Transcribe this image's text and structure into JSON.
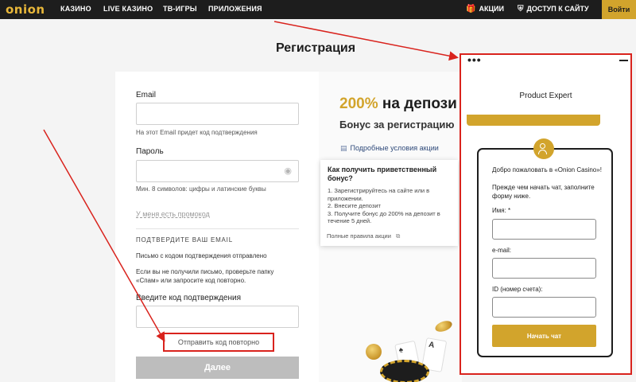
{
  "header": {
    "logo": "onion",
    "nav": [
      "КАЗИНО",
      "LIVE КАЗИНО",
      "ТВ-ИГРЫ",
      "ПРИЛОЖЕНИЯ"
    ],
    "promos_label": "АКЦИИ",
    "access_label": "ДОСТУП К САЙТУ",
    "login_label": "Войти"
  },
  "page": {
    "title": "Регистрация"
  },
  "form": {
    "email_label": "Email",
    "email_value": "",
    "email_hint": "На этот Email придет код подтверждения",
    "password_label": "Пароль",
    "password_value": "",
    "password_hint": "Мин. 8 символов: цифры и латинские буквы",
    "promo_link": "У меня есть промокод",
    "confirm_title": "ПОДТВЕРДИТЕ ВАШ EMAIL",
    "confirm_sent": "Письмо с кодом подтверждения отправлено",
    "confirm_help_1": "Если вы не получили письмо, проверьте папку",
    "confirm_help_2": "«Спам» или запросите код повторно.",
    "code_label": "Введите код подтверждения",
    "code_value": "",
    "resend_label": "Отправить код повторно",
    "next_label": "Далее"
  },
  "promo": {
    "bonus_percent": "200%",
    "bonus_rest": "на депози",
    "bonus_sub": "Бонус за регистрацию",
    "terms_link": "Подробные условия акции",
    "tooltip": {
      "title": "Как получить приветственный бонус?",
      "steps": [
        "1. Зарегистрируйтесь на сайте или в приложении.",
        "2. Внесите депозит",
        "3. Получите бонус до 200% на депозит в течение 5 дней."
      ],
      "rules_link": "Полные правила акции"
    }
  },
  "chat": {
    "menu_dots": "•••",
    "agent_title": "Product Expert",
    "intro_1": "Добро пожаловать в «Onion Casino»!",
    "intro_2": "Прежде чем начать чат, заполните форму ниже.",
    "name_label": "Имя: *",
    "email_label": "e-mail:",
    "account_label": "ID (номер счета):",
    "start_label": "Начать чат"
  },
  "colors": {
    "accent": "#d2a42c",
    "topbar": "#1d1d1d",
    "highlight": "#d9231d"
  }
}
